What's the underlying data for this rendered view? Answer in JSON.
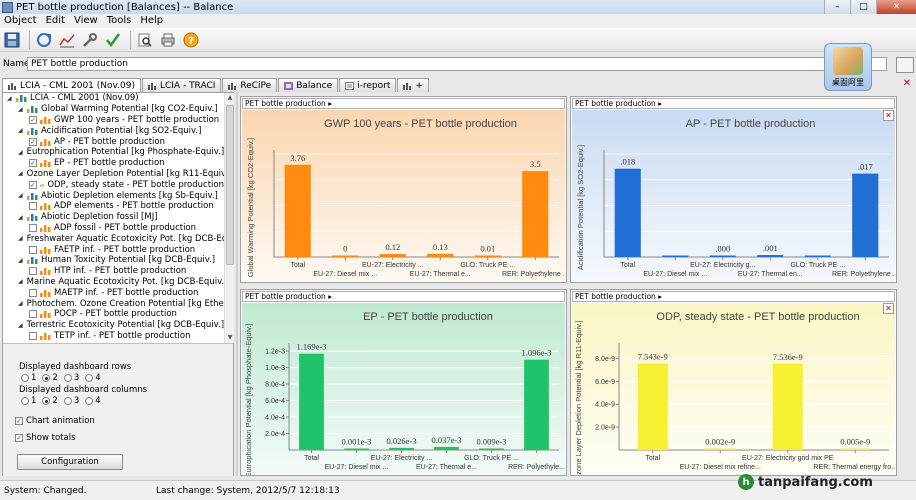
{
  "window": {
    "title": "PET bottle production [Balances] -- Balance",
    "buttons": [
      "–",
      "□",
      "✕"
    ]
  },
  "menu": [
    "Object",
    "Edit",
    "View",
    "Tools",
    "Help"
  ],
  "toolbar": {
    "icons": [
      "save-icon",
      "refresh-icon",
      "chart-icon",
      "tools-icon",
      "check-icon",
      "inspect-icon",
      "print-icon",
      "help-icon"
    ]
  },
  "name_field": {
    "label": "Name",
    "value": "PET bottle production"
  },
  "widget": {
    "label": "桌面阿里"
  },
  "tabs": [
    {
      "label": "LCIA - CML 2001 (Nov.09)",
      "active": true,
      "icon": "bars-icon"
    },
    {
      "label": "LCIA - TRACI",
      "active": false,
      "icon": "bars-icon"
    },
    {
      "label": "ReCiPe",
      "active": false,
      "icon": "bars-icon"
    },
    {
      "label": "Balance",
      "active": false,
      "icon": "balance-icon"
    },
    {
      "label": "i-report",
      "active": false,
      "icon": "report-icon"
    },
    {
      "label": "+",
      "active": false,
      "icon": "bars-icon"
    }
  ],
  "tree": [
    {
      "level": 0,
      "type": "root",
      "label": "LCIA - CML 2001 (Nov.09)"
    },
    {
      "level": 1,
      "type": "cat",
      "label": "Global Warming Potential [kg CO2-Equiv.]"
    },
    {
      "level": 2,
      "type": "item",
      "checked": true,
      "label": "GWP 100 years - PET bottle production"
    },
    {
      "level": 1,
      "type": "cat",
      "label": "Acidification Potential [kg SO2-Equiv.]"
    },
    {
      "level": 2,
      "type": "item",
      "checked": true,
      "label": "AP - PET bottle production"
    },
    {
      "level": 1,
      "type": "cat",
      "label": "Eutrophication Potential [kg Phosphate-Equiv.]"
    },
    {
      "level": 2,
      "type": "item",
      "checked": true,
      "label": "EP - PET bottle production"
    },
    {
      "level": 1,
      "type": "cat",
      "label": "Ozone Layer Depletion Potential [kg R11-Equiv.]"
    },
    {
      "level": 2,
      "type": "item",
      "checked": true,
      "label": "ODP, steady state - PET bottle production"
    },
    {
      "level": 1,
      "type": "cat",
      "label": "Abiotic Depletion elements [kg Sb-Equiv.]"
    },
    {
      "level": 2,
      "type": "item",
      "checked": false,
      "label": "ADP elements - PET bottle production"
    },
    {
      "level": 1,
      "type": "cat",
      "label": "Abiotic Depletion fossil [MJ]"
    },
    {
      "level": 2,
      "type": "item",
      "checked": false,
      "label": "ADP fossil - PET bottle production"
    },
    {
      "level": 1,
      "type": "cat",
      "label": "Freshwater Aquatic Ecotoxicity Pot. [kg DCB-Equiv.]"
    },
    {
      "level": 2,
      "type": "item",
      "checked": false,
      "label": "FAETP inf. - PET bottle production"
    },
    {
      "level": 1,
      "type": "cat",
      "label": "Human Toxicity Potential [kg DCB-Equiv.]"
    },
    {
      "level": 2,
      "type": "item",
      "checked": false,
      "label": "HTP inf. - PET bottle production"
    },
    {
      "level": 1,
      "type": "cat",
      "label": "Marine Aquatic Ecotoxicity Pot. [kg DCB-Equiv.]"
    },
    {
      "level": 2,
      "type": "item",
      "checked": false,
      "label": "MAETP inf. - PET bottle production"
    },
    {
      "level": 1,
      "type": "cat",
      "label": "Photochem. Ozone Creation Potential [kg Ethene-Equiv.]"
    },
    {
      "level": 2,
      "type": "item",
      "checked": false,
      "label": "POCP - PET bottle production"
    },
    {
      "level": 1,
      "type": "cat",
      "label": "Terrestric Ecotoxicity Potential [kg DCB-Equiv.]"
    },
    {
      "level": 2,
      "type": "item",
      "checked": false,
      "label": "TETP inf. - PET bottle production"
    }
  ],
  "options": {
    "rows_label": "Displayed dashboard rows",
    "rows": [
      "1",
      "2",
      "3",
      "4"
    ],
    "rows_selected": "2",
    "cols_label": "Displayed dashboard columns",
    "cols": [
      "1",
      "2",
      "3",
      "4"
    ],
    "cols_selected": "2",
    "chart_animation": {
      "label": "Chart animation",
      "checked": true
    },
    "show_totals": {
      "label": "Show totals",
      "checked": true
    },
    "config_button": "Configuration"
  },
  "status": {
    "left": "System: Changed.",
    "right": "Last change: System, 2012/5/7 12:18:13"
  },
  "watermark": {
    "text": "tanpaifang.com",
    "mark": "h"
  },
  "chart_data": [
    {
      "type": "bar",
      "header": "PET bottle production",
      "title": "GWP 100 years - PET bottle production",
      "ylabel": "Global Warming Potential [kg CO2-Equiv.]",
      "ylim": [
        0,
        4.2
      ],
      "yticks": [],
      "color": "#ff8a10",
      "bg": [
        "#fad6b0",
        "#fffaf3"
      ],
      "categories": [
        "Total",
        "EU-27: Diesel mix ...",
        "EU-27: Electricity ...",
        "EU-27: Thermal e...",
        "GLO: Truck PE ...",
        "RER: Polyethylene ..."
      ],
      "xrows": [
        0,
        1,
        0,
        1,
        0,
        1
      ],
      "values": [
        3.76,
        0.02,
        0.12,
        0.13,
        0.01,
        3.5
      ],
      "labels": [
        "3.76",
        "0",
        "0.12",
        "0.13",
        "0.01",
        "3.5"
      ]
    },
    {
      "type": "bar",
      "header": "PET bottle production",
      "title": "AP - PET bottle production",
      "ylabel": "Acidification Potential [kg SO2-Equiv.]",
      "ylim": [
        0,
        0.021
      ],
      "yticks": [],
      "color": "#1f6fd4",
      "bg": [
        "#c9dbf2",
        "#f6f9fd"
      ],
      "categories": [
        "Total",
        "EU-27: Diesel mix ...",
        "EU-27: Electricity g...",
        "EU-27: Thermal en...",
        "GLO: Truck PE ...",
        "RER: Polyethylene ..."
      ],
      "xrows": [
        0,
        1,
        0,
        1,
        0,
        1
      ],
      "values": [
        0.018,
        0.0001,
        0.0003,
        0.0004,
        0.0001,
        0.017
      ],
      "labels": [
        ".018",
        "",
        ".000",
        ".001",
        "",
        ".017"
      ]
    },
    {
      "type": "bar",
      "header": "PET bottle production",
      "title": "EP - PET bottle production",
      "ylabel": "Eutrophication Potential [kg Phosphate-Equiv.]",
      "ylim": [
        0,
        0.00125
      ],
      "yticks": [
        "1.2e-3",
        "1.0e-3",
        "8.0e-4",
        "6.0e-4",
        "4.0e-4",
        "2.0e-4"
      ],
      "ytick_vals": [
        0.0012,
        0.001,
        0.0008,
        0.0006,
        0.0004,
        0.0002
      ],
      "color": "#1fc46a",
      "bg": [
        "#bfe9d2",
        "#f3fbf7"
      ],
      "categories": [
        "Total",
        "EU-27: Diesel mix ...",
        "EU-27: Electricity ...",
        "EU-27: Thermal e...",
        "GLO: Truck PE ...",
        "RER: Polyethyle..."
      ],
      "xrows": [
        0,
        1,
        0,
        1,
        0,
        1
      ],
      "values": [
        0.001169,
        1e-06,
        2.6e-05,
        3.7e-05,
        9e-06,
        0.001096
      ],
      "labels": [
        "1.169e-3",
        "0.001e-3",
        "0.026e-3",
        "0.037e-3",
        "0.009e-3",
        "1.096e-3"
      ]
    },
    {
      "type": "bar",
      "header": "PET bottle production",
      "title": "ODP, steady state - PET bottle production",
      "ylabel": "Ozone Layer Depletion Potential [kg R11-Equiv.]",
      "ylim": [
        0,
        9e-09
      ],
      "yticks": [
        "8.0e-9",
        "6.0e-9",
        "4.0e-9",
        "2.0e-9"
      ],
      "ytick_vals": [
        8e-09,
        6e-09,
        4e-09,
        2e-09
      ],
      "color": "#f5f030",
      "bg": [
        "#fbf6c4",
        "#fffef6"
      ],
      "categories": [
        "Total",
        "EU-27: Diesel mix refine...",
        "EU-27: Electricity grid mix PE",
        "RER: Thermal energy fro..."
      ],
      "xrows": [
        0,
        1,
        0,
        1
      ],
      "values": [
        7.543e-09,
        2e-12,
        7.536e-09,
        5e-12
      ],
      "labels": [
        "7.543e-9",
        "0.002e-9",
        "7.536e-9",
        "0.005e-9"
      ]
    }
  ]
}
